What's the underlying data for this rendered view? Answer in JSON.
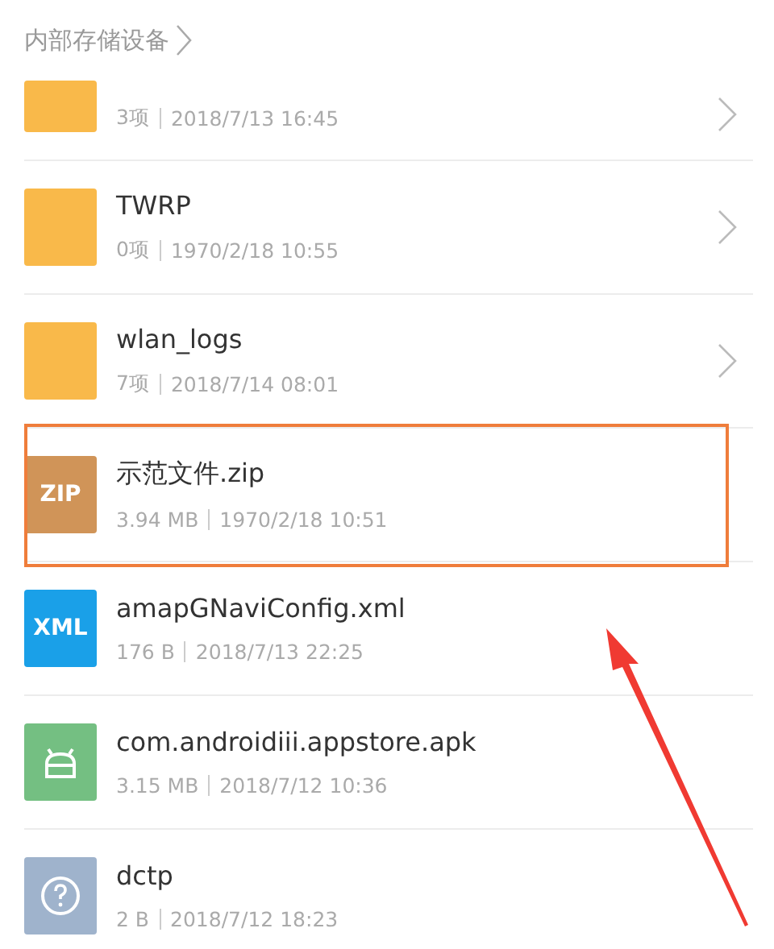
{
  "breadcrumb": {
    "label": "内部存储设备"
  },
  "files": [
    {
      "kind": "folder",
      "cut": true,
      "size": "3项",
      "date": "2018/7/13 16:45",
      "highlighted": false
    },
    {
      "kind": "folder",
      "cut": false,
      "name": "TWRP",
      "size": "0项",
      "date": "1970/2/18 10:55",
      "highlighted": false
    },
    {
      "kind": "folder",
      "cut": false,
      "name": "wlan_logs",
      "size": "7项",
      "date": "2018/7/14 08:01",
      "highlighted": false
    },
    {
      "kind": "zip",
      "cut": false,
      "badge": "ZIP",
      "name": "示范文件.zip",
      "size": "3.94 MB",
      "date": "1970/2/18 10:51",
      "highlighted": true
    },
    {
      "kind": "xml",
      "cut": false,
      "badge": "XML",
      "name": "amapGNaviConfig.xml",
      "size": "176 B",
      "date": "2018/7/13 22:25",
      "highlighted": false
    },
    {
      "kind": "apk",
      "cut": false,
      "name": "com.androidiii.appstore.apk",
      "size": "3.15 MB",
      "date": "2018/7/12 10:36",
      "highlighted": false
    },
    {
      "kind": "unknown",
      "cut": false,
      "name": "dctp",
      "size": "2 B",
      "date": "2018/7/12 18:23",
      "highlighted": false
    }
  ],
  "arrow_annotation": true
}
